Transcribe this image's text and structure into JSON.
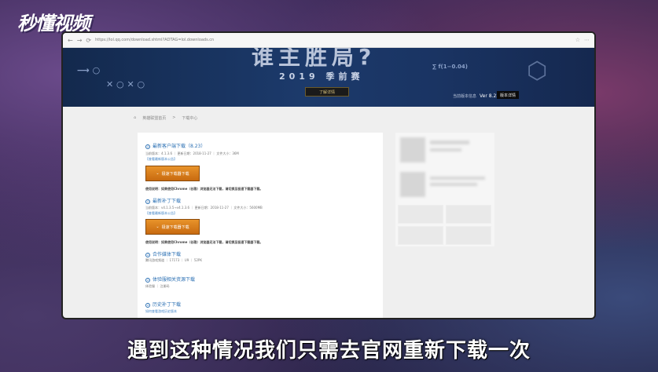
{
  "overlay": {
    "logo": "秒懂视频",
    "subtitle": "遇到这种情况我们只需去官网重新下载一次"
  },
  "browser": {
    "url": "https://lol.qq.com/download.shtml?ADTAG=lol.downloads.cn",
    "back": "←",
    "forward": "→",
    "refresh": "⟳"
  },
  "banner": {
    "title": "谁主胜局?",
    "season": "2019 季前赛",
    "learn_more": "了解详情",
    "version_label": "当前版本信息",
    "version": "Ver 8.23",
    "changelog": "版本详情"
  },
  "breadcrumb": {
    "home": "英雄联盟首页",
    "sep": ">",
    "current": "下载中心"
  },
  "sections": [
    {
      "title": "最新客户端下载（8.23）",
      "meta": "当前版本：4.1.3.6 ｜ 更新日期：2018-11-27 ｜ 文件大小：36M",
      "link": "【查看最新版本公告】",
      "button": "极速下载器下载",
      "tip": "使用说明：如果使用Chrome（谷歌）浏览器无法下载，请切换至极速下载器下载。"
    },
    {
      "title": "最新补丁下载",
      "meta": "当前版本：v4.1.3.5→v4.1.3.6 ｜ 更新日期：2018-11-27 ｜ 文件大小：5600MB",
      "link": "【查看最新版本公告】",
      "button": "极速下载器下载",
      "tip": "使用说明：如果使用Chrome（谷歌）浏览器无法下载，请切换至极速下载器下载。"
    },
    {
      "title": "合作媒体下载",
      "meta": "腾讯游戏频道 ｜ 17173 ｜ U9 ｜ 52PK"
    },
    {
      "title": "体验服相关资源下载",
      "meta": "体验服 ｜ 注册码"
    },
    {
      "title": "历史补丁下载",
      "link": "如何查看游戏历史版本"
    }
  ],
  "colors": {
    "accent": "#2a6fb3",
    "button": "#d97a1a",
    "banner": "#1a3463"
  }
}
